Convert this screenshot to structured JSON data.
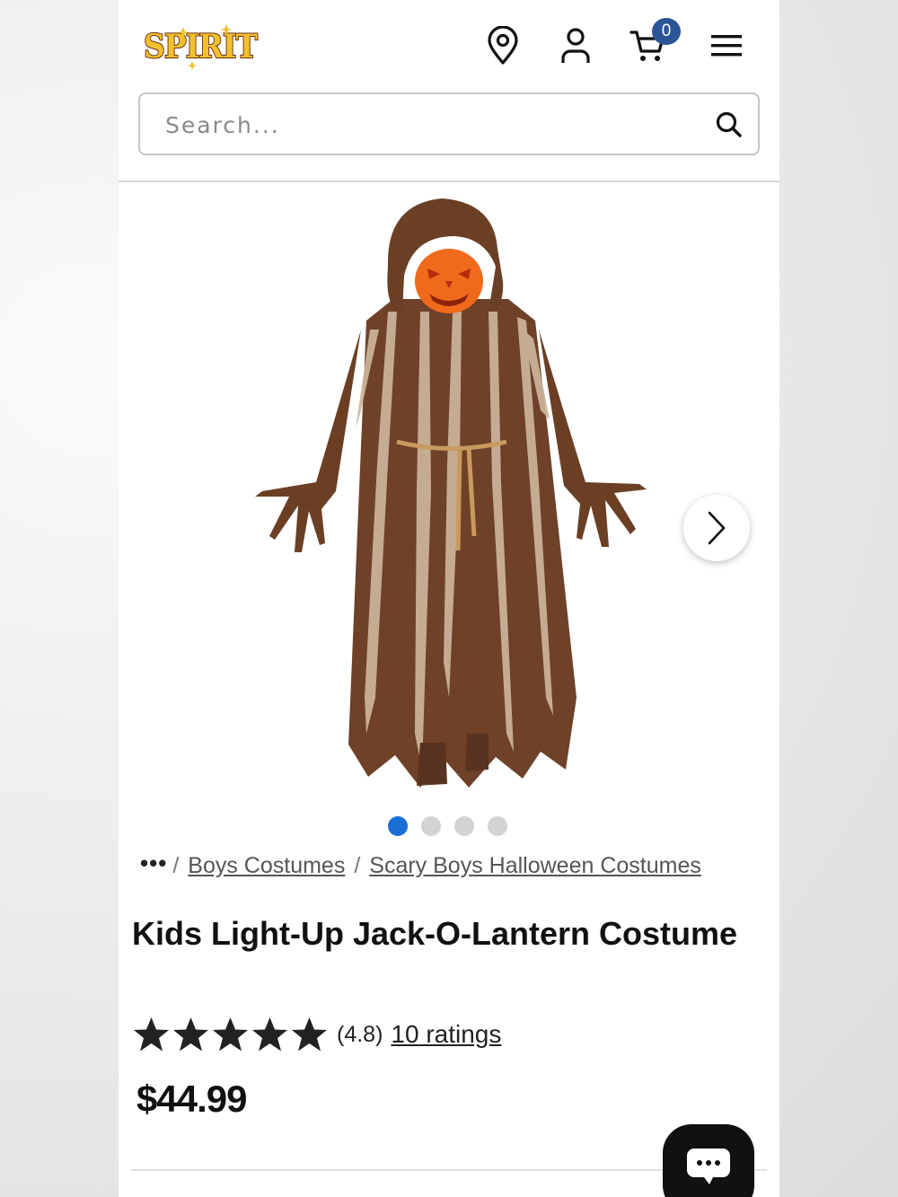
{
  "header": {
    "logo_text": "SPIRIT",
    "cart_count": "0",
    "icons": [
      "map-pin-icon",
      "account-icon",
      "cart-icon",
      "hamburger-menu-icon"
    ]
  },
  "search": {
    "placeholder": "Search...",
    "value": ""
  },
  "gallery": {
    "image_count": 4,
    "active_index": 0
  },
  "breadcrumb": {
    "more": "•••",
    "separator": "/",
    "items": [
      {
        "label": "Boys Costumes"
      },
      {
        "label": "Scary Boys Halloween Costumes"
      }
    ]
  },
  "product": {
    "title": "Kids Light-Up Jack-O-Lantern Costume",
    "rating_value": 4.8,
    "rating_text": "(4.8)",
    "ratings_count_text": "10 ratings",
    "price": "$44.99"
  },
  "colors": {
    "cart_badge": "#2a5596",
    "active_dot": "#1a6fd4",
    "logo_gold": "#f2c12e",
    "logo_outline": "#6b2e12"
  }
}
